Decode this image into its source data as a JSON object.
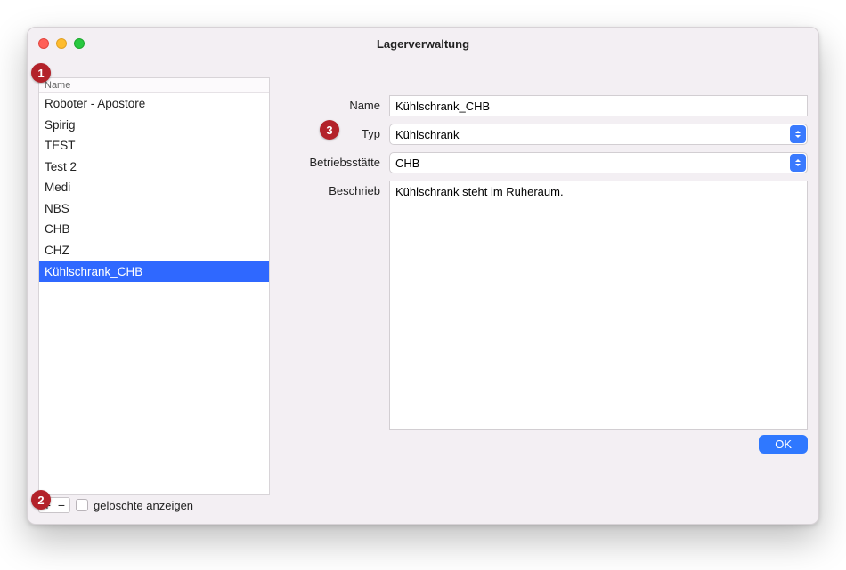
{
  "window": {
    "title": "Lagerverwaltung"
  },
  "list": {
    "header": "Name",
    "items": [
      "Roboter - Apostore",
      "Spirig",
      "TEST",
      "Test 2",
      "Medi",
      "NBS",
      "CHB",
      "CHZ",
      "Kühlschrank_CHB"
    ],
    "selected_index": 8,
    "show_deleted_label": "gelöschte anzeigen"
  },
  "form": {
    "name_label": "Name",
    "name_value": "Kühlschrank_CHB",
    "type_label": "Typ",
    "type_value": "Kühlschrank",
    "site_label": "Betriebsstätte",
    "site_value": "CHB",
    "desc_label": "Beschrieb",
    "desc_value": "Kühlschrank steht im Ruheraum."
  },
  "buttons": {
    "ok": "OK"
  },
  "badges": {
    "b1": "1",
    "b2": "2",
    "b3": "3"
  }
}
